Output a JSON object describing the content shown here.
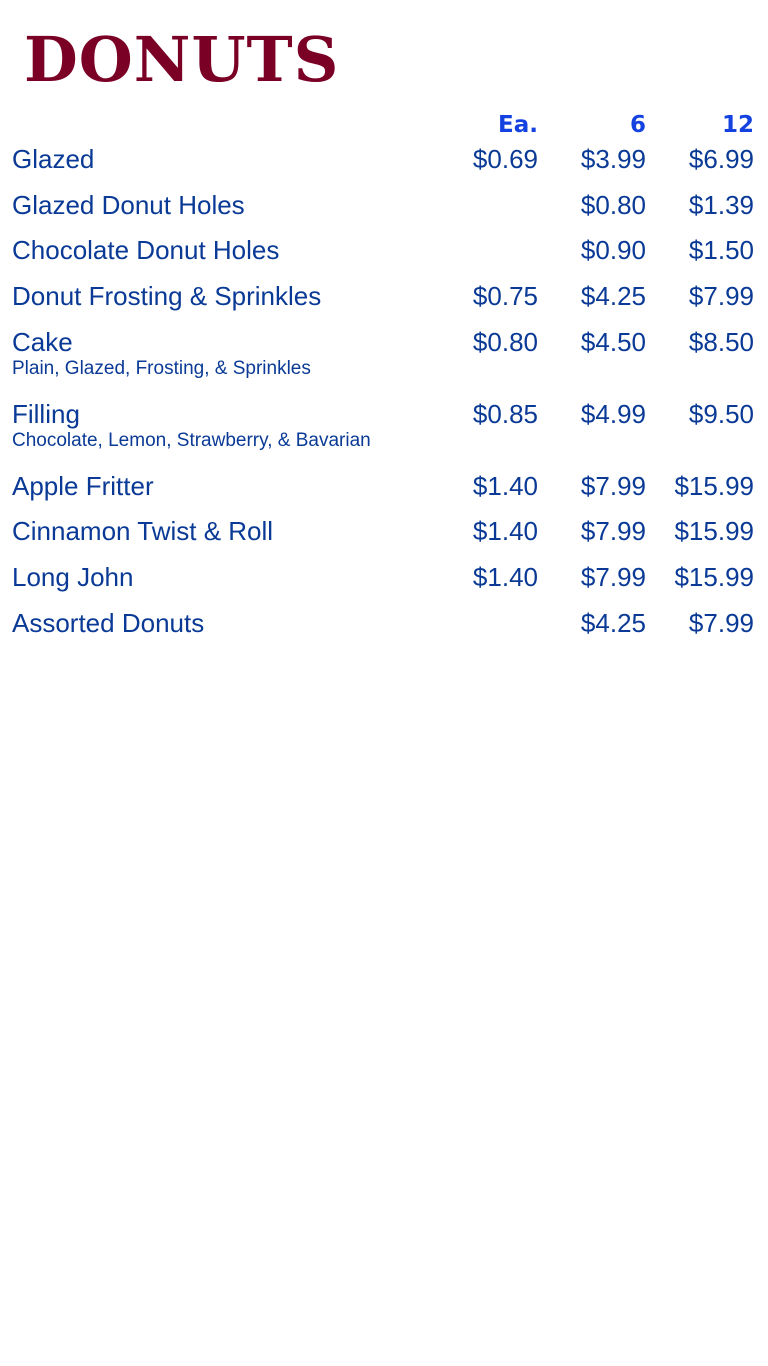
{
  "title": "DONUTS",
  "columns": {
    "each": "Ea.",
    "six": "6",
    "twelve": "12"
  },
  "colors": {
    "title": "#7a0026",
    "header": "#1442e0",
    "text": "#0a3a96"
  },
  "items": [
    {
      "name": "Glazed",
      "sub": "",
      "ea": "$0.69",
      "six": "$3.99",
      "twelve": "$6.99"
    },
    {
      "name": "Glazed Donut Holes",
      "sub": "",
      "ea": "",
      "six": "$0.80",
      "twelve": "$1.39"
    },
    {
      "name": "Chocolate Donut Holes",
      "sub": "",
      "ea": "",
      "six": "$0.90",
      "twelve": "$1.50"
    },
    {
      "name": "Donut Frosting & Sprinkles",
      "sub": "",
      "ea": "$0.75",
      "six": "$4.25",
      "twelve": "$7.99"
    },
    {
      "name": "Cake",
      "sub": "Plain, Glazed, Frosting, & Sprinkles",
      "ea": "$0.80",
      "six": "$4.50",
      "twelve": "$8.50"
    },
    {
      "name": "Filling",
      "sub": "Chocolate, Lemon, Strawberry, & Bavarian",
      "ea": "$0.85",
      "six": "$4.99",
      "twelve": "$9.50"
    },
    {
      "name": "Apple Fritter",
      "sub": "",
      "ea": "$1.40",
      "six": "$7.99",
      "twelve": "$15.99"
    },
    {
      "name": "Cinnamon Twist & Roll",
      "sub": "",
      "ea": "$1.40",
      "six": "$7.99",
      "twelve": "$15.99"
    },
    {
      "name": "Long John",
      "sub": "",
      "ea": "$1.40",
      "six": "$7.99",
      "twelve": "$15.99"
    },
    {
      "name": "Assorted Donuts",
      "sub": "",
      "ea": "",
      "six": "$4.25",
      "twelve": "$7.99"
    }
  ]
}
